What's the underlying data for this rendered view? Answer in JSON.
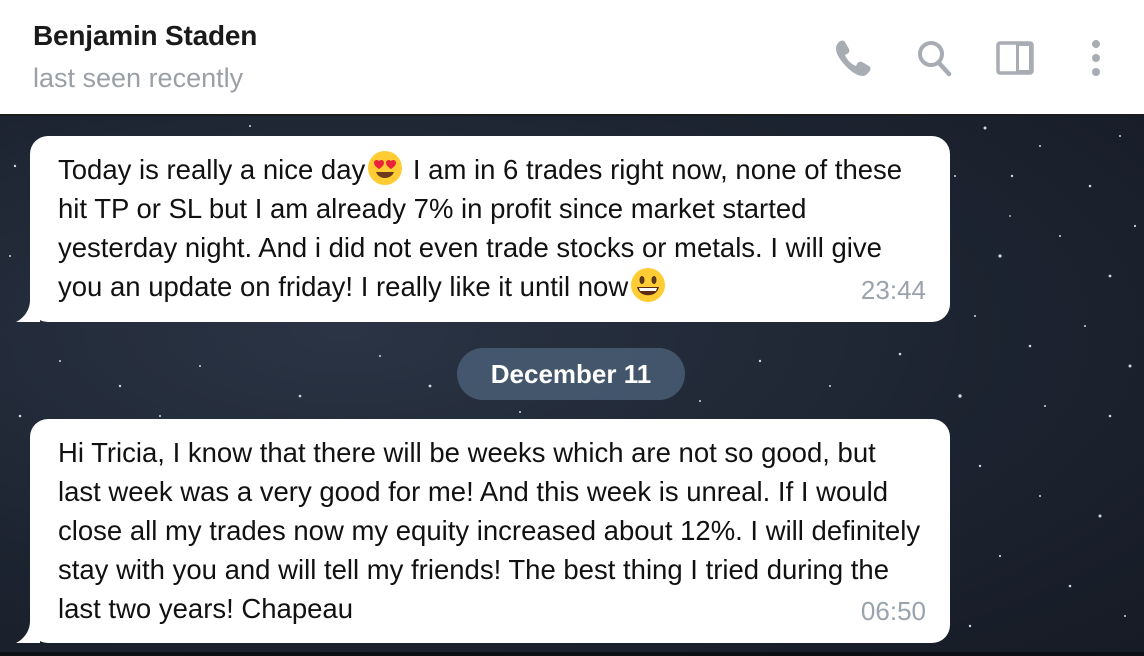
{
  "header": {
    "contact_name": "Benjamin Staden",
    "status": "last seen recently",
    "icons": [
      "phone-icon",
      "search-icon",
      "sidebar-toggle-icon",
      "more-vertical-icon"
    ]
  },
  "messages": [
    {
      "parts": [
        "Today is really a nice day",
        " I am in 6 trades right now, none of these hit TP or SL but I am already 7% in profit since market started yesterday night. And i did not even trade stocks or metals. I will give you an update on friday! I really like it until now"
      ],
      "emojis": [
        "heart-eyes-emoji",
        "grinning-emoji"
      ],
      "time": "23:44"
    },
    {
      "text": "Hi Tricia, I know that there will be weeks which are not so good, but last week was a very good for me! And this week is unreal. If I would close all my trades now my equity increased about 12%. I will definitely stay with you and will tell my friends! The best thing I tried during the last two years! Chapeau",
      "time": "06:50"
    }
  ],
  "date_separator": "December 11",
  "colors": {
    "header_bg": "#ffffff",
    "bubble_bg": "#ffffff",
    "chat_bg": "#1f2633",
    "date_pill_bg": "#4c627a",
    "time_text": "#9aa3ad",
    "status_text": "#9aa0a6",
    "icon_color": "#a8adb3"
  }
}
